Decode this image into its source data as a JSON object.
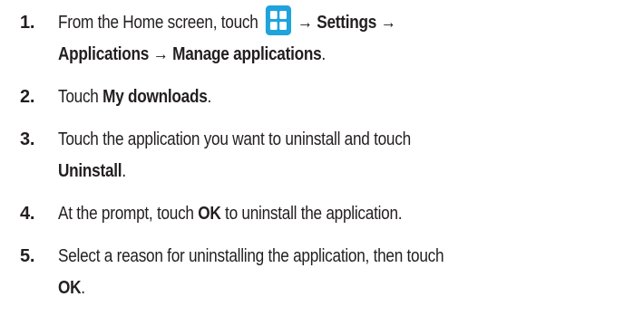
{
  "steps": [
    {
      "number": "1.",
      "text_start": "From the Home screen, touch ",
      "icon": "applications-grid-icon",
      "icon_color": "#1fa3dc",
      "arrow1": "→",
      "settings": "Settings",
      "arrow2": "→",
      "applications": "Applications",
      "arrow3": "→",
      "manage": "Manage applications",
      "text_end": "."
    },
    {
      "number": "2.",
      "text_start": "Touch ",
      "bold": "My downloads",
      "text_end": "."
    },
    {
      "number": "3.",
      "text_start": "Touch the application you want to uninstall and touch ",
      "bold": "Uninstall",
      "text_end": "."
    },
    {
      "number": "4.",
      "text_start": "At the prompt, touch ",
      "bold": "OK",
      "text_end": " to uninstall the application."
    },
    {
      "number": "5.",
      "text_start": "Select a reason for uninstalling the application, then touch ",
      "bold": "OK",
      "text_end": "."
    }
  ]
}
